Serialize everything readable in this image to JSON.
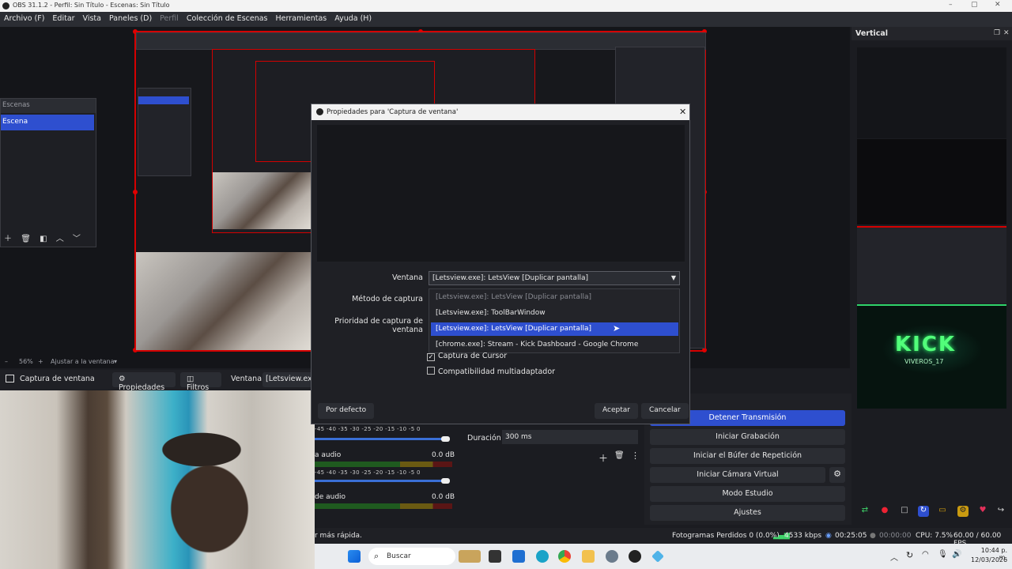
{
  "window": {
    "title": "OBS 31.1.2 - Perfil: Sin Título - Escenas: Sin Título"
  },
  "menu": {
    "archivo": "Archivo (F)",
    "editar": "Editar",
    "vista": "Vista",
    "paneles": "Paneles (D)",
    "perfil": "Perfil",
    "coleccion": "Colección de Escenas",
    "herramientas": "Herramientas",
    "ayuda": "Ayuda (H)"
  },
  "scenes": {
    "header": "Escenas",
    "selected": "Escena"
  },
  "zoom": {
    "value": "56%",
    "fit": "Ajustar a la ventana"
  },
  "source_bar": {
    "source": "Captura de ventana",
    "properties": "Propiedades",
    "filters": "Filtros",
    "window_label": "Ventana",
    "window_value": "[Letsview.exe]:"
  },
  "dialog": {
    "title": "Propiedades para 'Captura de ventana'",
    "window_label": "Ventana",
    "window_value": "[Letsview.exe]: LetsView [Duplicar pantalla]",
    "method_label": "Método de captura",
    "priority_label": "Prioridad de captura de ventana",
    "options": [
      "[Letsview.exe]: LetsView [Duplicar pantalla]",
      "[Letsview.exe]: ToolBarWindow",
      "[Letsview.exe]: LetsView [Duplicar pantalla]",
      "[chrome.exe]: Stream - Kick Dashboard - Google Chrome"
    ],
    "cursor": "Captura de Cursor",
    "multi": "Compatibilidad multiadaptador",
    "defaults": "Por defecto",
    "ok": "Aceptar",
    "cancel": "Cancelar"
  },
  "vertical": {
    "title": "Vertical",
    "kick": "KICK",
    "kick_sub": "VIVEROS_17"
  },
  "controls": {
    "stop_stream": "Detener Transmisión",
    "start_rec": "Iniciar Grabación",
    "replay": "Iniciar el Búfer de Repetición",
    "virtual_cam": "Iniciar Cámara Virtual",
    "studio": "Modo Estudio",
    "settings": "Ajustes"
  },
  "mixer": {
    "scale": "-45  -40  -35  -30  -25  -20  -15  -10   -5   0",
    "ch1_name": "a audio",
    "ch1_db": "0.0 dB",
    "ch2_name": "de audio",
    "ch2_db": "0.0 dB"
  },
  "transitions": {
    "duration_label": "Duración",
    "duration_value": "300 ms"
  },
  "status": {
    "hint": "r más rápida.",
    "dropped": "Fotogramas Perdidos 0 (0.0%)",
    "bitrate": "4533 kbps",
    "stream_time": "00:25:05",
    "rec_time": "00:00:00",
    "cpu": "CPU: 7.5%",
    "fps": "60.00 / 60.00 FPS"
  },
  "taskbar": {
    "search": "Buscar",
    "time": "10:44 p. m.",
    "date": "12/03/2026"
  },
  "colors": {
    "accent": "#2e4fcf",
    "selection_red": "#d40000",
    "kick_green": "#52ff7a"
  }
}
